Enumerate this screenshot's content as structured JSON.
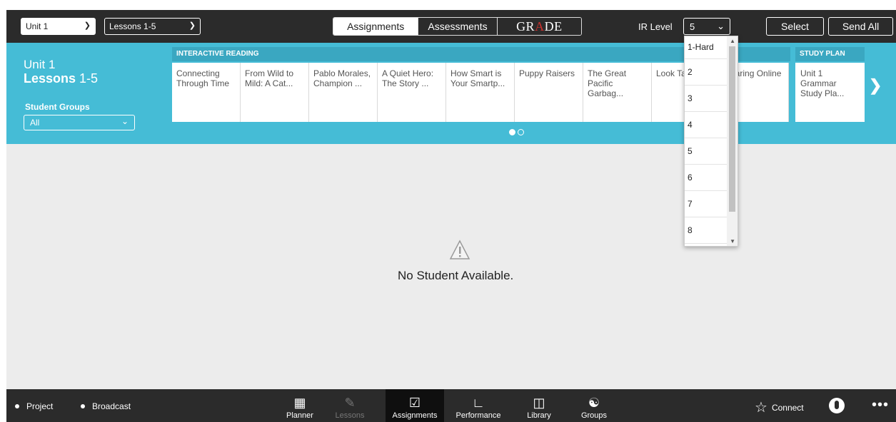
{
  "topbar": {
    "unit_select": "Unit 1",
    "lessons_select": "Lessons 1-5",
    "tabs": [
      "Assignments",
      "Assessments"
    ],
    "grade_logo": {
      "pre": "GR",
      "accent": "A",
      "post": "DE"
    },
    "ir_label": "IR Level",
    "ir_value": "5",
    "select_button": "Select",
    "send_all_button": "Send All"
  },
  "banner": {
    "unit": "Unit 1",
    "lessons_word": "Lessons",
    "lessons_range": "1-5",
    "student_groups_label": "Student Groups",
    "group_value": "All",
    "interactive_reading_header": "INTERACTIVE READING",
    "study_plan_header": "STUDY PLAN",
    "cards": [
      "Connecting Through Time",
      "From Wild to Mild: A Cat...",
      "Pablo Morales, Champion ...",
      "A Quiet Hero: The Story ...",
      "How Smart is Your Smartp...",
      "Puppy Raisers",
      "The Great Pacific Garbag...",
      "Look Talkin",
      "Sharing Online"
    ],
    "study_plan_card": "Unit 1 Grammar Study Pla..."
  },
  "ir_dropdown": {
    "options": [
      "1-Hard",
      "2",
      "3",
      "4",
      "5",
      "6",
      "7",
      "8"
    ]
  },
  "empty_state": {
    "message": "No Student Available."
  },
  "bottombar": {
    "project": "Project",
    "broadcast": "Broadcast",
    "nav": [
      "Planner",
      "Lessons",
      "Assignments",
      "Performance",
      "Library",
      "Groups"
    ],
    "connect": "Connect"
  },
  "colors": {
    "banner": "#45bcd6",
    "bar": "#2b2b2b",
    "grade_accent": "#c9302c"
  }
}
